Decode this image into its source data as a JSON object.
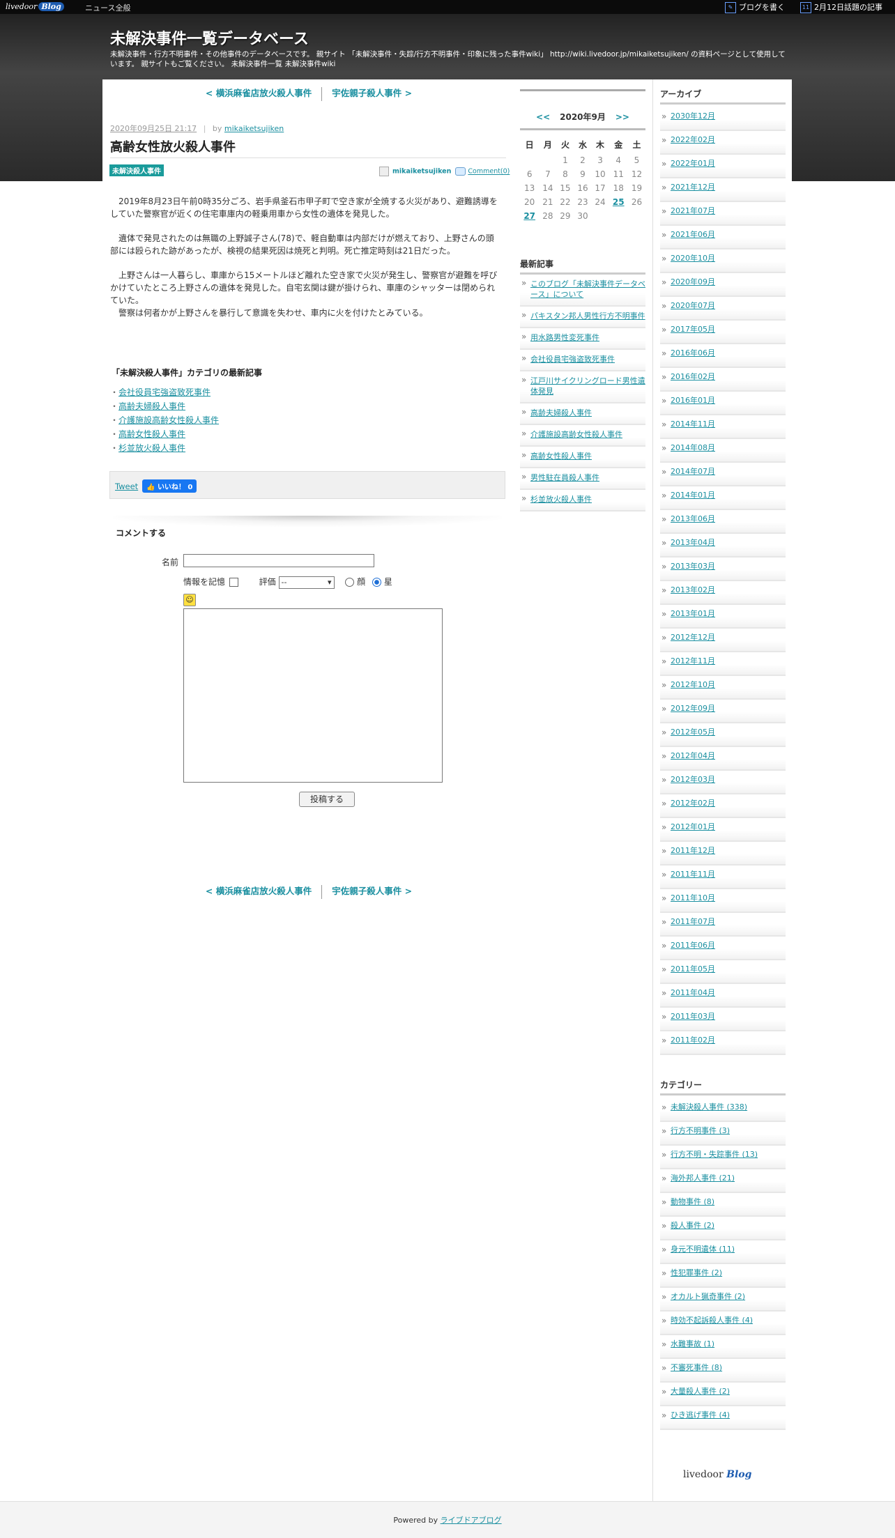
{
  "topbar": {
    "logo_main": "livedoor",
    "logo_sub": "Blog",
    "news": "ニュース全般",
    "write": "ブログを書く",
    "topics": "2月12日話題の記事",
    "topics_icon": "11"
  },
  "site": {
    "title": "未解決事件一覧データベース",
    "description": "未解決事件・行方不明事件・その他事件のデータベースです。 親サイト 「未解決事件・失踪/行方不明事件・印象に残った事件wiki」 http://wiki.livedoor.jp/mikaiketsujiken/ の資料ページとして使用しています。 親サイトもご覧ください。 未解決事件一覧 未解決事件wiki"
  },
  "post_nav": {
    "prev": "< 横浜麻雀店放火殺人事件",
    "next": "宇佐親子殺人事件 >"
  },
  "post": {
    "date": "2020年09月25日 21:17",
    "by": "by",
    "author": "mikaiketsujiken",
    "title": "高齢女性放火殺人事件",
    "category": "未解決殺人事件",
    "comment_link": "Comment(0)",
    "paragraphs": [
      "　2019年8月23日午前0時35分ごろ、岩手県釜石市甲子町で空き家が全焼する火災があり、避難誘導をしていた警察官が近くの住宅車庫内の軽乗用車から女性の遺体を発見した。",
      "　遺体で発見されたのは無職の上野誠子さん(78)で、軽自動車は内部だけが燃えており、上野さんの頭部には殴られた跡があったが、検視の結果死因は焼死と判明。死亡推定時刻は21日だった。",
      "　上野さんは一人暮らし、車庫から15メートルほど離れた空き家で火災が発生し、警察官が避難を呼びかけていたところ上野さんの遺体を発見した。自宅玄関は鍵が掛けられ、車庫のシャッターは閉められていた。\n　警察は何者かが上野さんを暴行して意識を失わせ、車内に火を付けたとみている。"
    ]
  },
  "latest_in_category": {
    "heading": "「未解決殺人事件」カテゴリの最新記事",
    "items": [
      "会社役員宅強盗致死事件",
      "高齢夫婦殺人事件",
      "介護施設高齢女性殺人事件",
      "高齢女性殺人事件",
      "杉並放火殺人事件"
    ]
  },
  "share": {
    "tweet": "Tweet",
    "like": "いいね！ 0"
  },
  "comment_form": {
    "heading": "コメントする",
    "name_label": "名前",
    "remember_label": "情報を記憶",
    "rating_label": "評価",
    "rating_value": "--",
    "face_label": "顔",
    "star_label": "星",
    "submit": "投稿する"
  },
  "calendar": {
    "prev": "<<",
    "title": "2020年9月",
    "next": ">>",
    "weekdays": [
      "日",
      "月",
      "火",
      "水",
      "木",
      "金",
      "土"
    ],
    "weeks": [
      [
        "",
        "",
        "1",
        "2",
        "3",
        "4",
        "5"
      ],
      [
        "6",
        "7",
        "8",
        "9",
        "10",
        "11",
        "12"
      ],
      [
        "13",
        "14",
        "15",
        "16",
        "17",
        "18",
        "19"
      ],
      [
        "20",
        "21",
        "22",
        "23",
        "24",
        "25",
        "26"
      ],
      [
        "27",
        "28",
        "29",
        "30",
        "",
        "",
        ""
      ]
    ],
    "linked_days": [
      "25",
      "27"
    ]
  },
  "recent_posts": {
    "heading": "最新記事",
    "items": [
      "このブログ「未解決事件データベース」について",
      "パキスタン邦人男性行方不明事件",
      "用水路男性変死事件",
      "会社役員宅強盗致死事件",
      "江戸川サイクリングロード男性遺体発見",
      "高齢夫婦殺人事件",
      "介護施設高齢女性殺人事件",
      "高齢女性殺人事件",
      "男性駐在員殺人事件",
      "杉並放火殺人事件"
    ]
  },
  "archives": {
    "heading": "アーカイブ",
    "items": [
      "2030年12月",
      "2022年02月",
      "2022年01月",
      "2021年12月",
      "2021年07月",
      "2021年06月",
      "2020年10月",
      "2020年09月",
      "2020年07月",
      "2017年05月",
      "2016年06月",
      "2016年02月",
      "2016年01月",
      "2014年11月",
      "2014年08月",
      "2014年07月",
      "2014年01月",
      "2013年06月",
      "2013年04月",
      "2013年03月",
      "2013年02月",
      "2013年01月",
      "2012年12月",
      "2012年11月",
      "2012年10月",
      "2012年09月",
      "2012年05月",
      "2012年04月",
      "2012年03月",
      "2012年02月",
      "2012年01月",
      "2011年12月",
      "2011年11月",
      "2011年10月",
      "2011年07月",
      "2011年06月",
      "2011年05月",
      "2011年04月",
      "2011年03月",
      "2011年02月"
    ]
  },
  "categories": {
    "heading": "カテゴリー",
    "items": [
      "未解決殺人事件 (338)",
      "行方不明事件 (3)",
      "行方不明・失踪事件 (13)",
      "海外邦人事件 (21)",
      "動物事件 (8)",
      "殺人事件 (2)",
      "身元不明遺体 (11)",
      "性犯罪事件 (2)",
      "オカルト猟奇事件 (2)",
      "時効不起訴殺人事件 (4)",
      "水難事故 (1)",
      "不審死事件 (8)",
      "大量殺人事件 (2)",
      "ひき逃げ事件 (4)"
    ]
  },
  "badge": {
    "main": "livedoor",
    "sub": "Blog"
  },
  "footer": {
    "powered_by": "Powered by",
    "link": "ライブドアブログ"
  },
  "colors": {
    "accent": "#1a8fa0",
    "tag_bg": "#1a9b9b",
    "header_dark": "#2a2a2a"
  }
}
